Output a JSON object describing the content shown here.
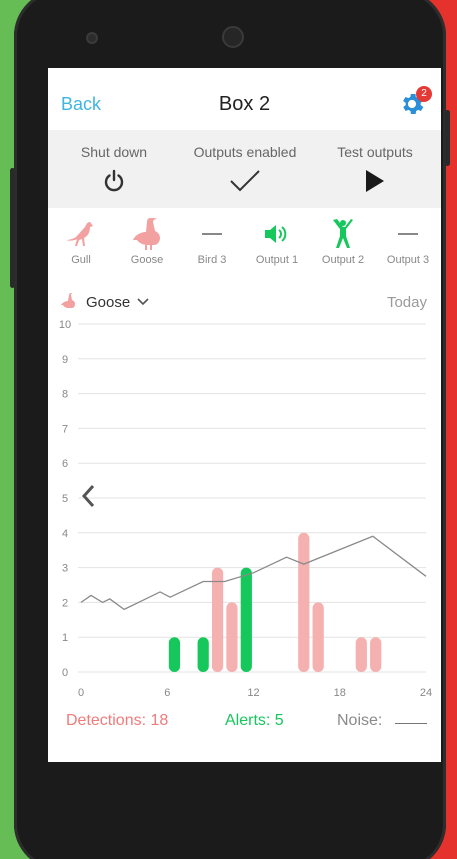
{
  "header": {
    "back_label": "Back",
    "title": "Box 2",
    "notification_count": "2"
  },
  "controls": [
    {
      "label": "Shut down",
      "icon": "power-icon"
    },
    {
      "label": "Outputs enabled",
      "icon": "checkmark-icon"
    },
    {
      "label": "Test outputs",
      "icon": "play-icon"
    }
  ],
  "birds": [
    {
      "label": "Gull",
      "icon": "gull-icon",
      "color": "#f2a0a0"
    },
    {
      "label": "Goose",
      "icon": "goose-icon",
      "color": "#f2a0a0"
    },
    {
      "label": "Bird 3",
      "icon": "dash-icon",
      "color": "#888888"
    },
    {
      "label": "Output 1",
      "icon": "speaker-icon",
      "color": "#16c75c"
    },
    {
      "label": "Output 2",
      "icon": "person-waving-icon",
      "color": "#16c75c"
    },
    {
      "label": "Output 3",
      "icon": "dash-icon",
      "color": "#888888"
    }
  ],
  "selector": {
    "value": "Goose",
    "period": "Today"
  },
  "stats": {
    "detections": "Detections: 18",
    "alerts": "Alerts: 5",
    "noise": "Noise:"
  },
  "colors": {
    "accent": "#3fb5e0",
    "detection": "#f5b0b0",
    "alert": "#16c75c",
    "noise": "#8a8a8a"
  },
  "chart_data": {
    "type": "bar",
    "xlim": [
      0,
      24
    ],
    "ylim": [
      0,
      10
    ],
    "xticks": [
      0,
      6,
      12,
      18,
      24
    ],
    "yticks": [
      0,
      1,
      2,
      3,
      4,
      5,
      6,
      7,
      8,
      9,
      10
    ],
    "series": [
      {
        "name": "Detections",
        "color": "#f5b0b0",
        "type": "bar",
        "points": [
          [
            9.5,
            3
          ],
          [
            10.5,
            2
          ],
          [
            15.5,
            4
          ],
          [
            16.5,
            2
          ],
          [
            19.5,
            1
          ],
          [
            20.5,
            1
          ]
        ]
      },
      {
        "name": "Alerts",
        "color": "#16c75c",
        "type": "bar",
        "points": [
          [
            6.5,
            1
          ],
          [
            8.5,
            1
          ],
          [
            11.5,
            3
          ]
        ]
      },
      {
        "name": "Noise",
        "color": "#8a8a8a",
        "type": "line",
        "points": [
          [
            0,
            2
          ],
          [
            0.7,
            2.2
          ],
          [
            1.5,
            2
          ],
          [
            2,
            2.1
          ],
          [
            3,
            1.8
          ],
          [
            4,
            2
          ],
          [
            5.5,
            2.3
          ],
          [
            6.2,
            2.15
          ],
          [
            8.5,
            2.6
          ],
          [
            10,
            2.6
          ],
          [
            12,
            2.85
          ],
          [
            14.3,
            3.3
          ],
          [
            15.5,
            3.1
          ],
          [
            20.3,
            3.9
          ],
          [
            24,
            2.75
          ]
        ]
      }
    ]
  }
}
